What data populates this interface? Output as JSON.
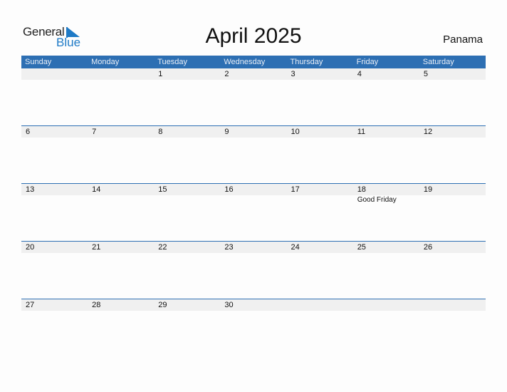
{
  "logo": {
    "line1": "General",
    "line2": "Blue"
  },
  "title": "April 2025",
  "country": "Panama",
  "accent_color": "#2d6fb3",
  "days": [
    "Sunday",
    "Monday",
    "Tuesday",
    "Wednesday",
    "Thursday",
    "Friday",
    "Saturday"
  ],
  "weeks": [
    [
      "",
      "",
      "1",
      "2",
      "3",
      "4",
      "5"
    ],
    [
      "6",
      "7",
      "8",
      "9",
      "10",
      "11",
      "12"
    ],
    [
      "13",
      "14",
      "15",
      "16",
      "17",
      "18",
      "19"
    ],
    [
      "20",
      "21",
      "22",
      "23",
      "24",
      "25",
      "26"
    ],
    [
      "27",
      "28",
      "29",
      "30",
      "",
      "",
      ""
    ]
  ],
  "holidays": [
    {
      "week": 2,
      "day": 5,
      "name": "Good Friday"
    }
  ]
}
